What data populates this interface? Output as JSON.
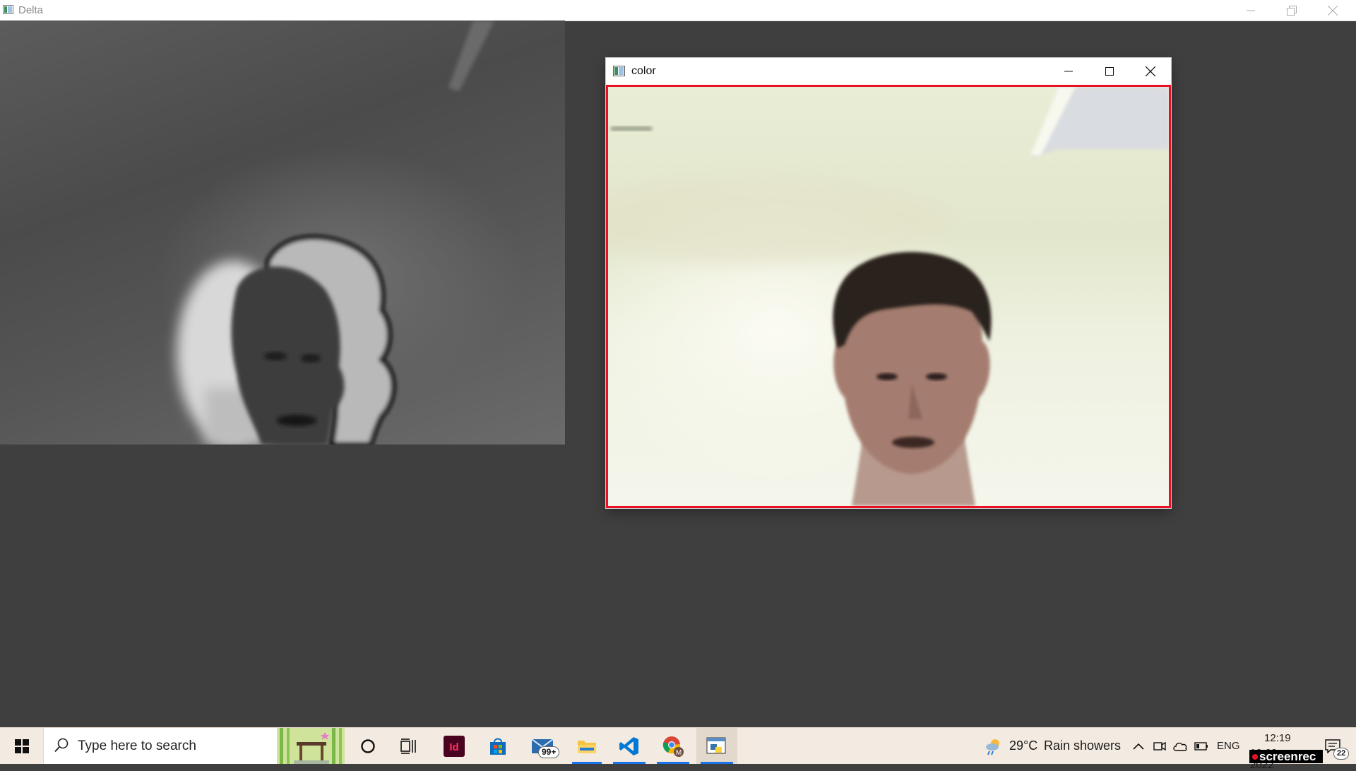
{
  "delta_window": {
    "title": "Delta"
  },
  "color_window": {
    "title": "color"
  },
  "taskbar": {
    "search_placeholder": "Type here to search",
    "mail_badge": "99+",
    "indesign_label": "Id",
    "chrome_profile": "M",
    "weather": {
      "temperature": "29°C",
      "condition": "Rain showers"
    },
    "language": "ENG",
    "time": "12:19",
    "date_partial": "10-09-2022",
    "notifications_count": "22"
  },
  "overlay": {
    "screenrec_label": "screenrec"
  },
  "colors": {
    "accent_red": "#e81123",
    "taskbar": "#f3ebe1",
    "desktop": "#3f3f3f"
  }
}
